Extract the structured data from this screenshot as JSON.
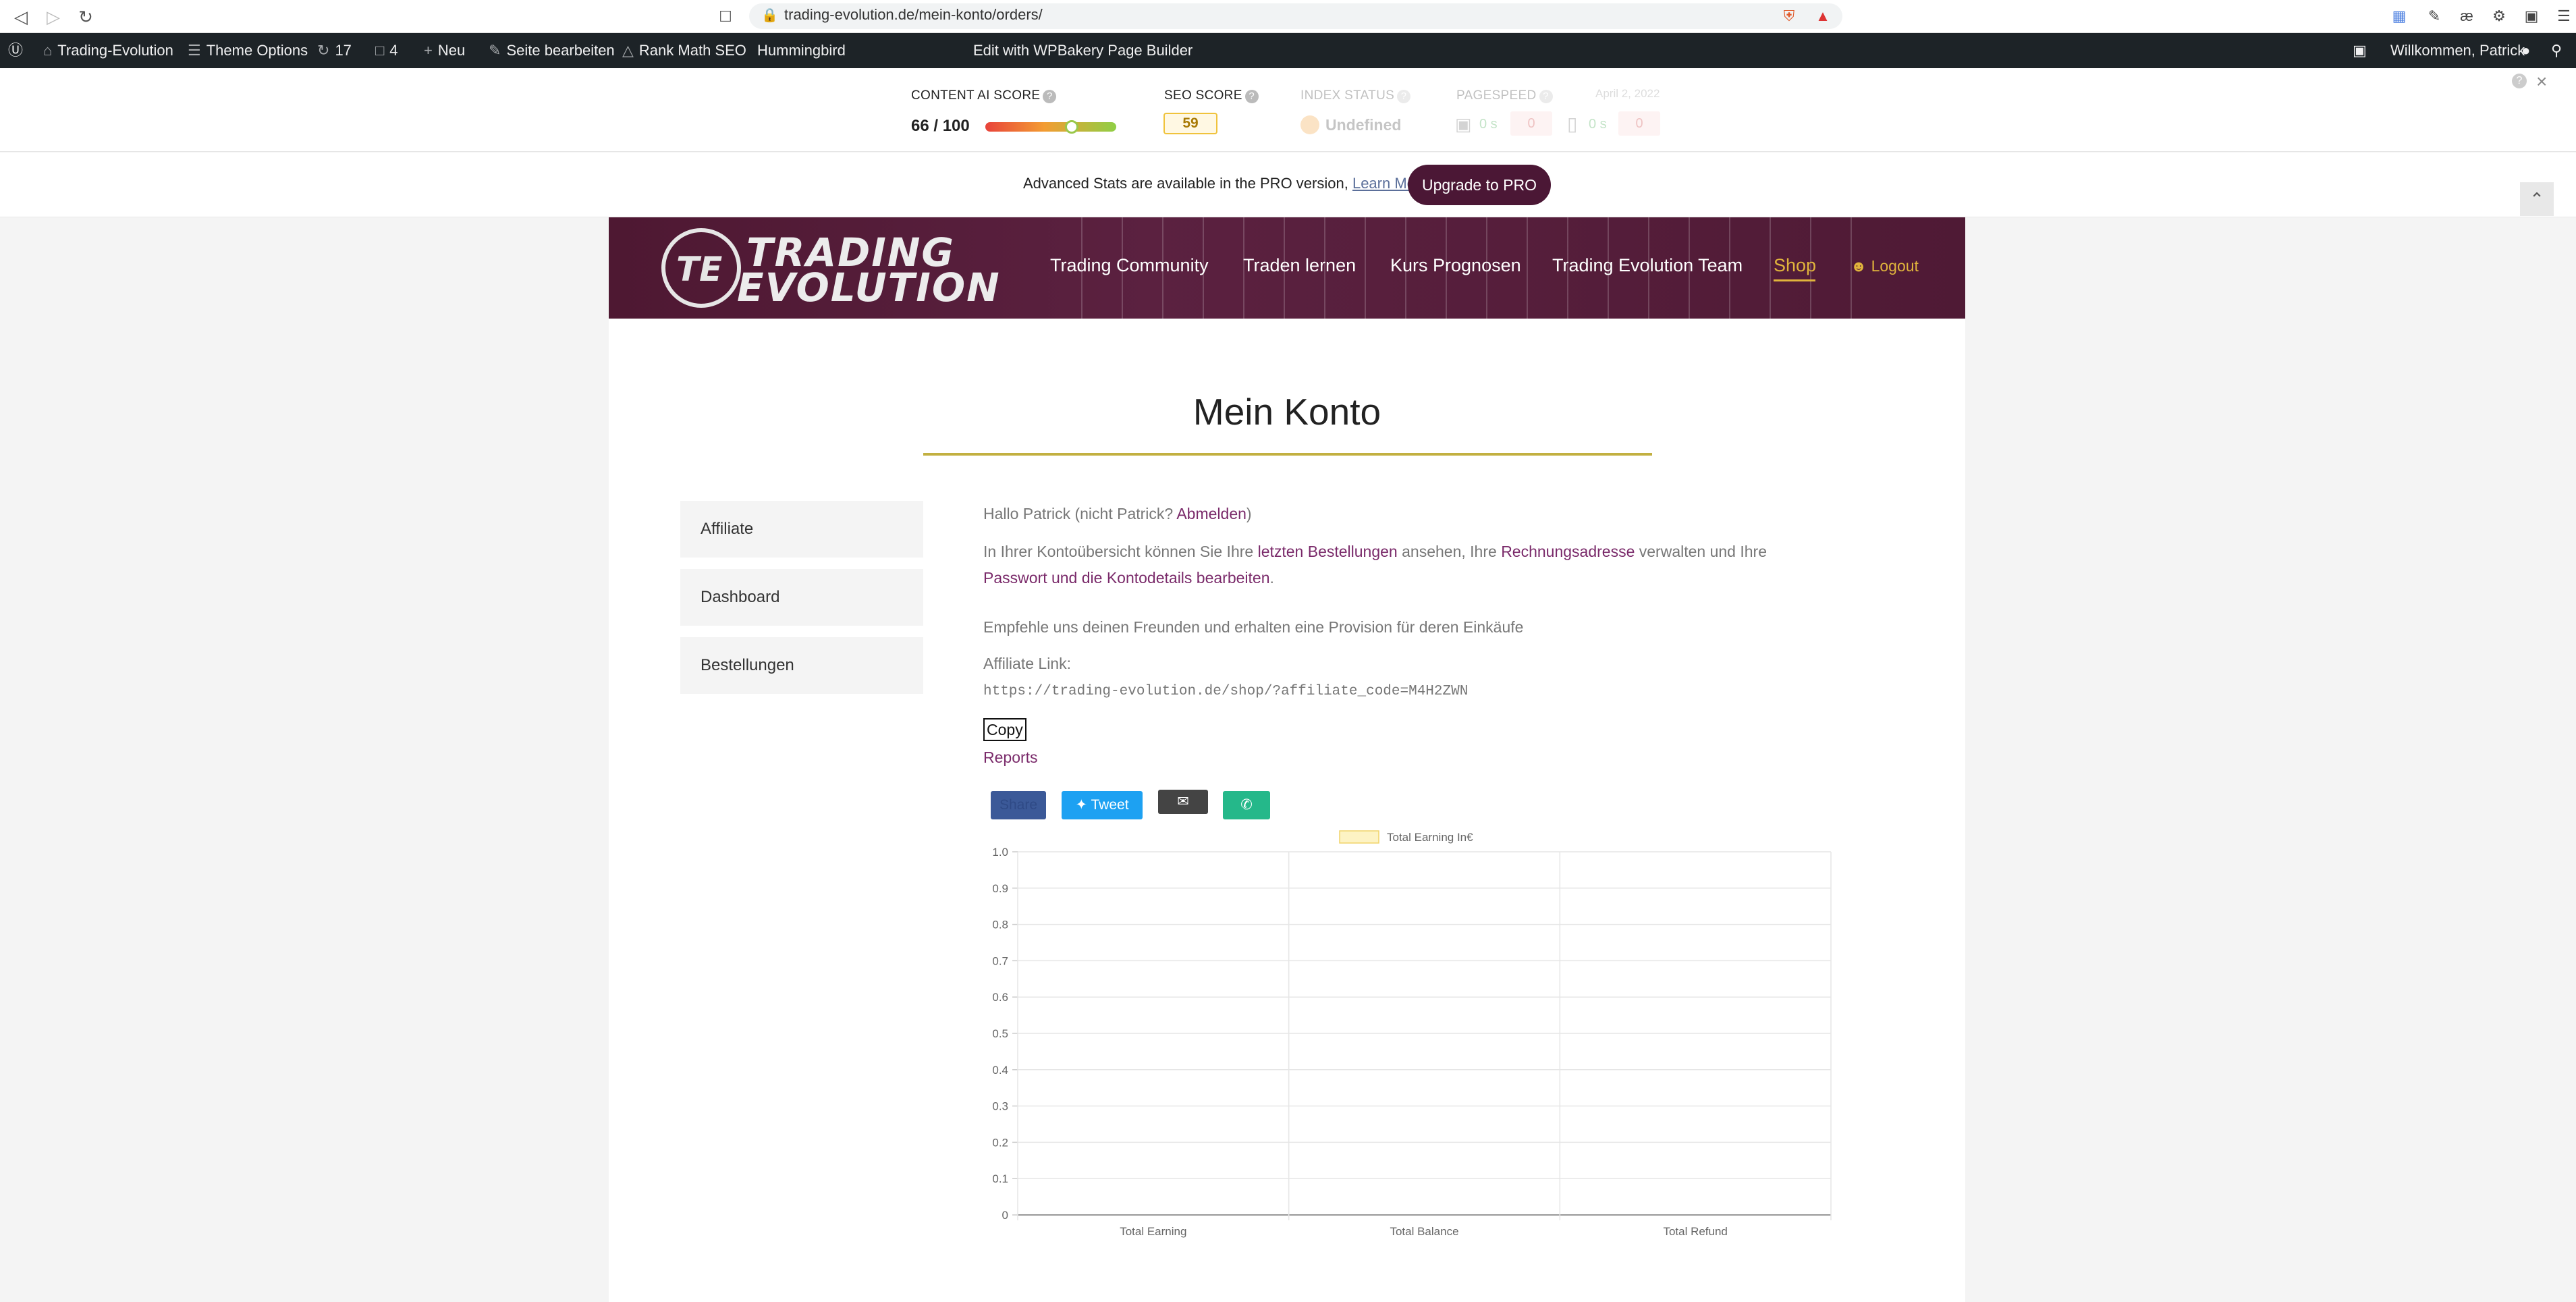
{
  "browser": {
    "url": "trading-evolution.de/mein-konto/orders/"
  },
  "wpbar": {
    "site_name": "Trading-Evolution",
    "theme_options": "Theme Options",
    "updates_count": "17",
    "comments_count": "4",
    "new_label": "Neu",
    "edit_page": "Seite bearbeiten",
    "rank_math": "Rank Math SEO",
    "hummingbird": "Hummingbird",
    "wpbakery": "Edit with WPBakery Page Builder",
    "welcome": "Willkommen, Patrick"
  },
  "rankmath": {
    "content_ai_label": "CONTENT AI SCORE",
    "content_ai_value": "66 / 100",
    "content_ai_fraction": 0.66,
    "seo_label": "SEO SCORE",
    "seo_value": "59",
    "index_label": "INDEX STATUS",
    "index_value": "Undefined",
    "pagespeed_label": "PAGESPEED",
    "pagespeed_date": "April 2, 2022",
    "ps_desktop_time": "0 s",
    "ps_desktop_score": "0",
    "ps_mobile_time": "0 s",
    "ps_mobile_score": "0"
  },
  "pro_notice": {
    "text": "Advanced Stats are available in the PRO version,",
    "link": "Learn More",
    "button": "Upgrade to PRO"
  },
  "site": {
    "logo_line1": "TRADING",
    "logo_line2": "EVOLUTION",
    "logo_mark": "TE",
    "menu": [
      "Trading Community",
      "Traden lernen",
      "Kurs Prognosen",
      "Trading Evolution Team",
      "Shop"
    ],
    "logout": "Logout"
  },
  "account": {
    "title": "Mein Konto",
    "sidebar": [
      "Affiliate",
      "Dashboard",
      "Bestellungen"
    ],
    "hello_prefix": "Hallo Patrick (nicht Patrick?",
    "hello_link": "Abmelden",
    "hello_suffix": ")",
    "overview_1": "In Ihrer Kontoübersicht können Sie Ihre",
    "overview_link1": "letzten Bestellungen",
    "overview_2": "ansehen, Ihre",
    "overview_link2": "Rechnungsadresse",
    "overview_3": "verwalten und Ihre",
    "overview_link3": "Passwort und die Kontodetails bearbeiten",
    "overview_4": ".",
    "recommend": "Empfehle uns deinen Freunden und erhalten eine Provision für deren Einkäufe",
    "affiliate_label": "Affiliate Link:",
    "affiliate_url": "https://trading-evolution.de/shop/?affiliate_code=M4H2ZWN",
    "copy": "Copy",
    "reports": "Reports",
    "share_facebook": "Share",
    "share_tweet": "Tweet"
  },
  "chart_data": {
    "type": "bar",
    "categories": [
      "Total Earning",
      "Total Balance",
      "Total Refund"
    ],
    "series": [
      {
        "name": "Total Earning In€",
        "values": [
          0,
          0,
          0
        ],
        "color": "#fdf3c4"
      }
    ],
    "ylim": [
      0,
      1.0
    ],
    "yticks": [
      "0",
      "0.1",
      "0.2",
      "0.3",
      "0.4",
      "0.5",
      "0.6",
      "0.7",
      "0.8",
      "0.9",
      "1.0"
    ],
    "grid": true,
    "legend": "top"
  },
  "colors": {
    "brand": "#4e1832",
    "accent": "#e0b43c",
    "link": "#7a2a6a",
    "wpbar": "#1d2327"
  }
}
